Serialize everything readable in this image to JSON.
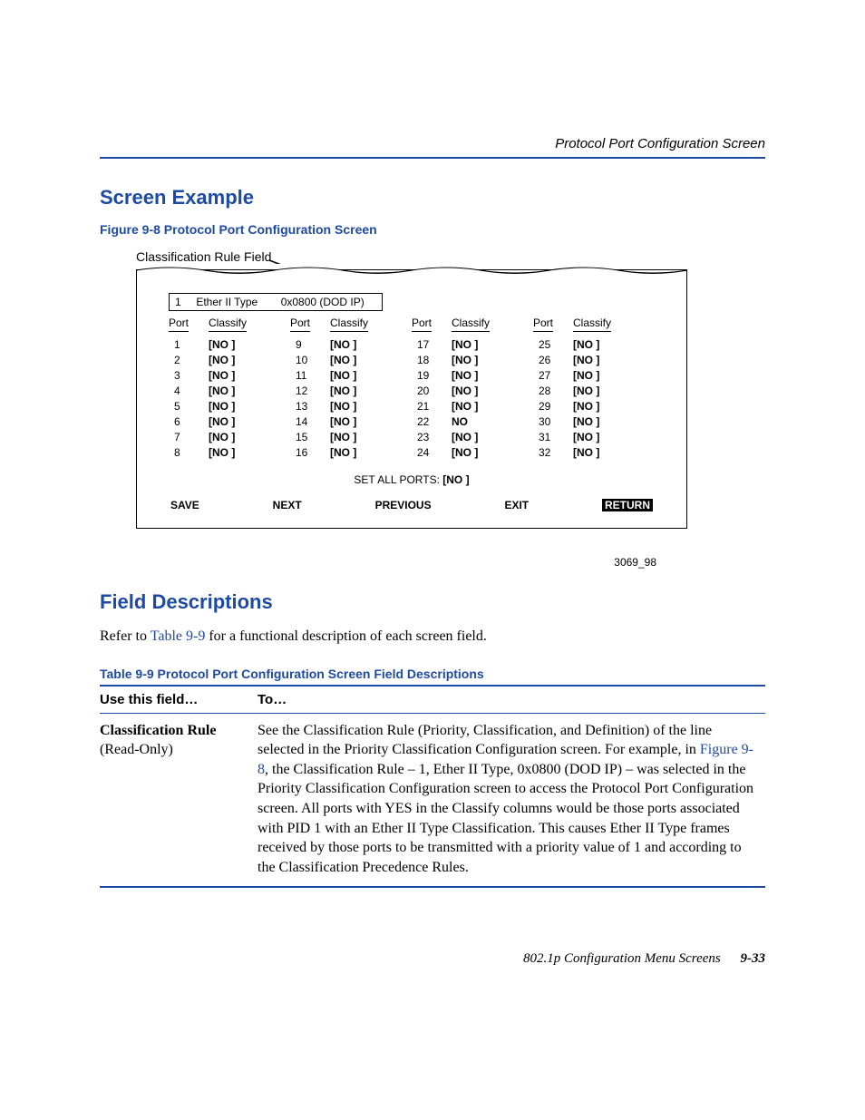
{
  "header": {
    "right": "Protocol Port Configuration Screen"
  },
  "section1": {
    "title": "Screen Example"
  },
  "figure": {
    "caption_prefix": "Figure 9-8",
    "caption_rest": "   Protocol Port Configuration Screen",
    "rule_label": "Classification Rule Field",
    "class_rule": {
      "pid": "1",
      "type": "Ether II Type",
      "def": "0x0800  (DOD IP)"
    },
    "col_head_port": "Port",
    "col_head_classify": "Classify",
    "columns": [
      [
        {
          "port": "1",
          "val": "[NO ]"
        },
        {
          "port": "2",
          "val": "[NO ]"
        },
        {
          "port": "3",
          "val": "[NO ]"
        },
        {
          "port": "4",
          "val": "[NO ]"
        },
        {
          "port": "5",
          "val": "[NO ]"
        },
        {
          "port": "6",
          "val": "[NO ]"
        },
        {
          "port": "7",
          "val": "[NO ]"
        },
        {
          "port": "8",
          "val": "[NO ]"
        }
      ],
      [
        {
          "port": "9",
          "val": "[NO ]"
        },
        {
          "port": "10",
          "val": "[NO ]"
        },
        {
          "port": "11",
          "val": "[NO ]"
        },
        {
          "port": "12",
          "val": "[NO ]"
        },
        {
          "port": "13",
          "val": "[NO ]"
        },
        {
          "port": "14",
          "val": "[NO ]"
        },
        {
          "port": "15",
          "val": "[NO ]"
        },
        {
          "port": "16",
          "val": "[NO ]"
        }
      ],
      [
        {
          "port": "17",
          "val": "[NO ]"
        },
        {
          "port": "18",
          "val": "[NO ]"
        },
        {
          "port": "19",
          "val": "[NO ]"
        },
        {
          "port": "20",
          "val": "[NO ]"
        },
        {
          "port": "21",
          "val": "[NO ]"
        },
        {
          "port": "22",
          "val": "NO"
        },
        {
          "port": "23",
          "val": "[NO ]"
        },
        {
          "port": "24",
          "val": "[NO ]"
        }
      ],
      [
        {
          "port": "25",
          "val": "[NO ]"
        },
        {
          "port": "26",
          "val": "[NO ]"
        },
        {
          "port": "27",
          "val": "[NO ]"
        },
        {
          "port": "28",
          "val": "[NO ]"
        },
        {
          "port": "29",
          "val": "[NO ]"
        },
        {
          "port": "30",
          "val": "[NO ]"
        },
        {
          "port": "31",
          "val": "[NO ]"
        },
        {
          "port": "32",
          "val": "[NO ]"
        }
      ]
    ],
    "set_all_label": "SET ALL PORTS: ",
    "set_all_val": "[NO ]",
    "buttons": {
      "save": "SAVE",
      "next": "NEXT",
      "prev": "PREVIOUS",
      "exit": "EXIT",
      "ret": "RETURN"
    },
    "fig_id": "3069_98"
  },
  "section2": {
    "title": "Field Descriptions"
  },
  "body": {
    "refer_pre": "Refer to ",
    "refer_link": "Table 9-9",
    "refer_post": " for a functional description of each screen field."
  },
  "table": {
    "caption_prefix": "Table 9-9",
    "caption_rest": "   Protocol Port Configuration Screen Field Descriptions",
    "head_field": "Use this field…",
    "head_to": "To…",
    "row1_field_name": "Classification Rule",
    "row1_field_sub": "(Read-Only)",
    "row1_desc_a": "See the Classification Rule (Priority, Classification, and Definition) of the line selected in the Priority Classification Configuration screen. For example, in ",
    "row1_desc_link": "Figure 9-8",
    "row1_desc_b": ", the Classification Rule – 1, Ether II Type, 0x0800 (DOD IP) – was selected in the Priority Classification Configuration screen to access the Protocol Port Configuration screen. All ports with YES in the Classify columns would be those ports associated with PID 1 with an Ether II Type Classification. This causes Ether II Type frames received by those ports to be transmitted with a priority value of 1 and according to the Classification Precedence Rules."
  },
  "footer": {
    "text": "802.1p Configuration Menu Screens",
    "page": "9-33"
  }
}
